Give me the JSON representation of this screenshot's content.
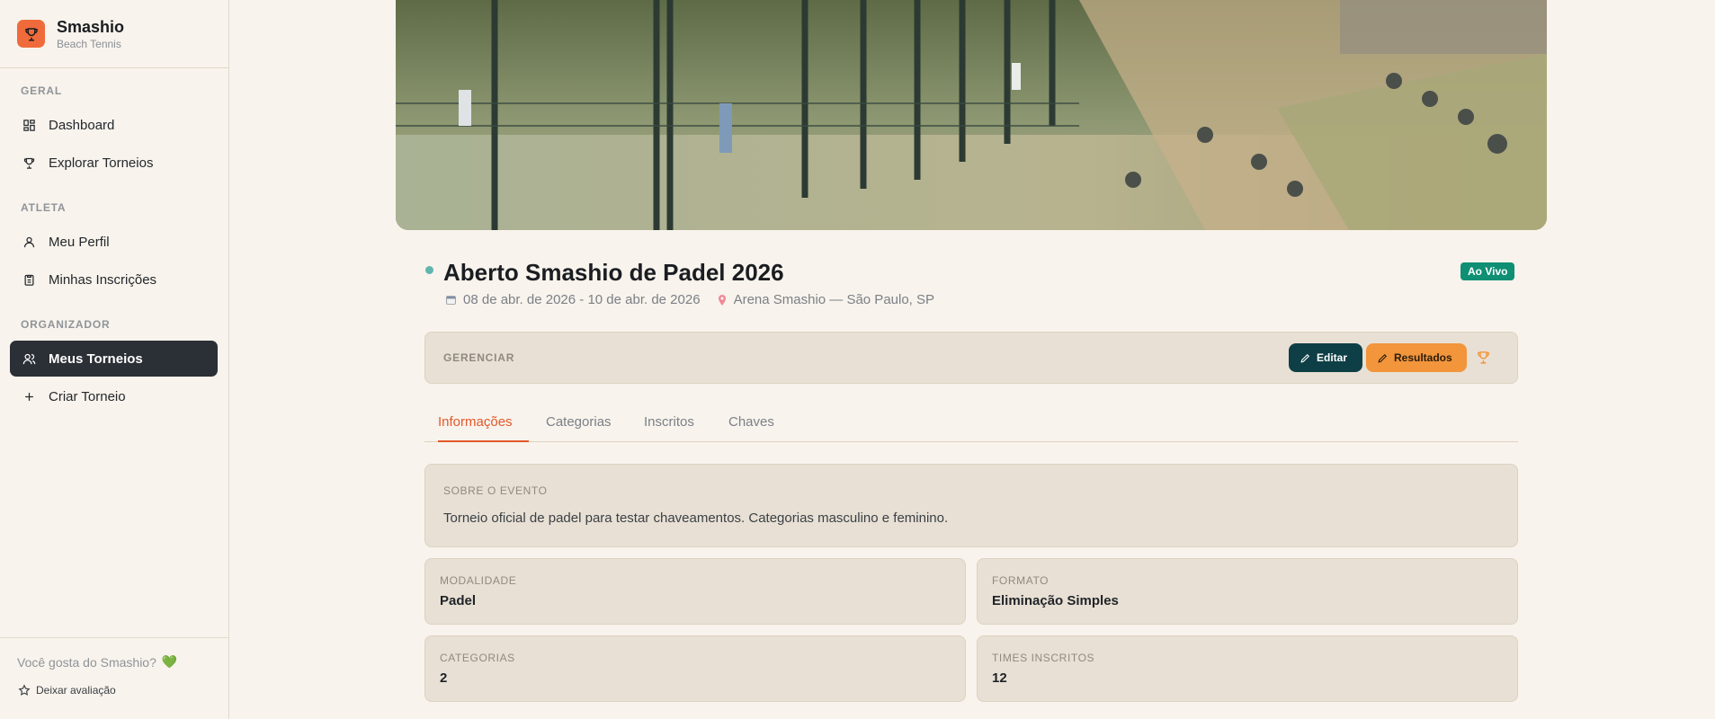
{
  "brand": {
    "name": "Smashio",
    "subtitle": "Beach Tennis"
  },
  "nav": {
    "sections": [
      {
        "label": "GERAL"
      },
      {
        "label": "ATLETA"
      },
      {
        "label": "ORGANIZADOR"
      }
    ],
    "items": [
      {
        "label": "Dashboard",
        "icon": "dashboard-icon"
      },
      {
        "label": "Explorar Torneios",
        "icon": "trophy-icon"
      },
      {
        "label": "Meu Perfil",
        "icon": "user-icon"
      },
      {
        "label": "Minhas Inscrições",
        "icon": "clipboard-icon"
      },
      {
        "label": "Meus Torneios",
        "icon": "users-icon",
        "active": true
      },
      {
        "label": "Criar Torneio",
        "icon": "plus-icon"
      }
    ]
  },
  "footer": {
    "question": "Você gosta do Smashio?",
    "heart": "💚",
    "review_label": "Deixar avaliação"
  },
  "tournament": {
    "title": "Aberto Smashio de Padel 2026",
    "dates": "08 de abr. de 2026 - 10 de abr. de 2026",
    "location": "Arena Smashio — São Paulo, SP",
    "status": "Ao Vivo"
  },
  "manage": {
    "label": "GERENCIAR",
    "edit_label": "Editar",
    "results_label": "Resultados"
  },
  "tabs": [
    {
      "label": "Informações",
      "active": true
    },
    {
      "label": "Categorias"
    },
    {
      "label": "Inscritos"
    },
    {
      "label": "Chaves"
    }
  ],
  "about": {
    "label": "SOBRE O EVENTO",
    "text": "Torneio oficial de padel para testar chaveamentos. Categorias masculino e feminino."
  },
  "stats": {
    "modalidade": {
      "label": "MODALIDADE",
      "value": "Padel"
    },
    "formato": {
      "label": "FORMATO",
      "value": "Eliminação Simples"
    },
    "categorias": {
      "label": "CATEGORIAS",
      "value": "2"
    },
    "times": {
      "label": "TIMES INSCRITOS",
      "value": "12"
    }
  },
  "colors": {
    "accent": "#e2582b",
    "live": "#0f8f74",
    "edit": "#0f3f46",
    "results": "#f2953b",
    "sidebar_active": "#2b2f36"
  }
}
